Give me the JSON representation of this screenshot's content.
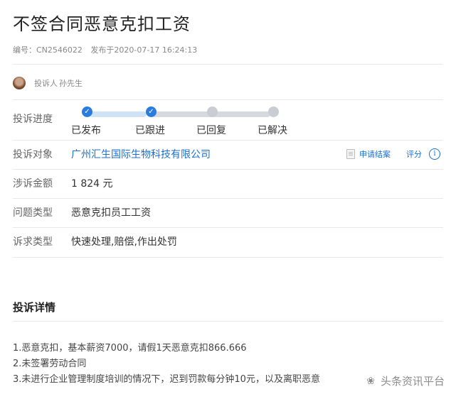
{
  "title": "不签合同恶意克扣工资",
  "meta": {
    "id": "编号：CN2546022",
    "published": "发布于2020-07-17 16:24:13"
  },
  "complainant": {
    "label": "投诉人",
    "name": "孙先生"
  },
  "progress": {
    "label": "投诉进度",
    "steps": [
      {
        "label": "已发布",
        "done": true
      },
      {
        "label": "已跟进",
        "done": true
      },
      {
        "label": "已回复",
        "done": false
      },
      {
        "label": "已解决",
        "done": false
      }
    ]
  },
  "target": {
    "label": "投诉对象",
    "value": "广州汇生国际生物科技有限公司"
  },
  "actions": {
    "apply_close": "申请结案",
    "rate": "评分",
    "info": "i"
  },
  "amount": {
    "label": "涉诉金额",
    "value": "1 824 元"
  },
  "issue_type": {
    "label": "问题类型",
    "value": "恶意克扣员工工资"
  },
  "demand_type": {
    "label": "诉求类型",
    "value": "快速处理,赔偿,作出处罚"
  },
  "details": {
    "title": "投诉详情",
    "lines": [
      "1.恶意克扣，基本薪资7000，请假1天恶意克扣866.666",
      "2.未签署劳动合同",
      "3.未进行企业管理制度培训的情况下，迟到罚款每分钟10元，以及离职恶意"
    ]
  },
  "watermark": {
    "text": "头条资讯平台"
  }
}
